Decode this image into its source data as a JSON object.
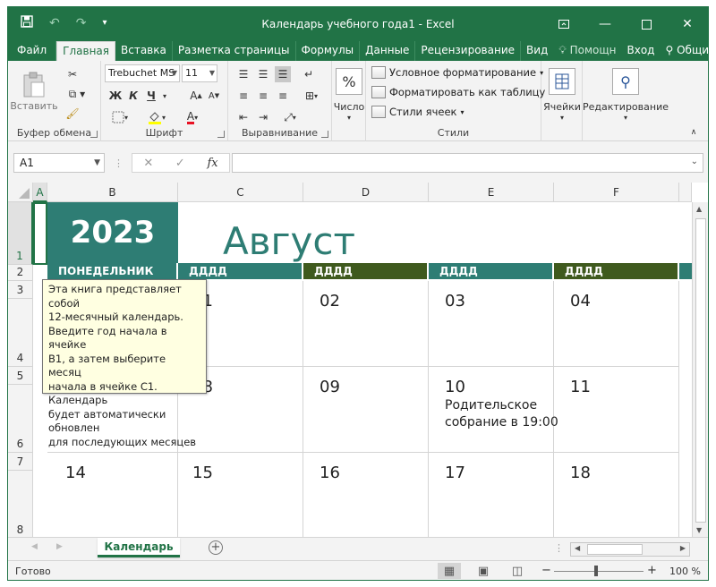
{
  "window": {
    "title": "Календарь учебного года1 - Excel"
  },
  "tabs": {
    "file": "Файл",
    "home": "Главная",
    "insert": "Вставка",
    "layout": "Разметка страницы",
    "formulas": "Формулы",
    "data": "Данные",
    "review": "Рецензирование",
    "view": "Вид",
    "help": "Помощн",
    "login": "Вход",
    "share": "Общий доступ"
  },
  "ribbon": {
    "clipboard": {
      "label": "Буфер обмена",
      "paste": "Вставить"
    },
    "font": {
      "label": "Шрифт",
      "name": "Trebuchet MS",
      "size": "11",
      "bold": "Ж",
      "italic": "К",
      "underline": "Ч"
    },
    "alignment": {
      "label": "Выравнивание"
    },
    "number": {
      "label": "Число",
      "percent_symbol": "%"
    },
    "styles": {
      "label": "Стили",
      "conditional": "Условное форматирование",
      "as_table": "Форматировать как таблицу",
      "cell_styles": "Стили ячеек"
    },
    "cells": {
      "label": "Ячейки"
    },
    "editing": {
      "label": "Редактирование"
    }
  },
  "formula_bar": {
    "name_box": "A1",
    "fx": "fx",
    "value": ""
  },
  "columns": [
    "A",
    "B",
    "C",
    "D",
    "E",
    "F"
  ],
  "rows": [
    "1",
    "2",
    "3",
    "4",
    "5",
    "6",
    "7",
    "8"
  ],
  "calendar": {
    "year": "2023",
    "month": "Август",
    "day_headers": [
      "ПОНЕДЕЛЬНИК",
      "ДДДД",
      "ДДДД",
      "ДДДД",
      "ДДДД"
    ],
    "week1": [
      "01",
      "02",
      "03",
      "04"
    ],
    "week2": [
      "08",
      "09",
      "10",
      "11"
    ],
    "week3": [
      "14",
      "15",
      "16",
      "17",
      "18"
    ],
    "event_line1": "Родительское",
    "event_line2": "собрание в 19:00"
  },
  "tooltip": {
    "lines": [
      "Эта книга представляет собой",
      "12-месячный календарь.",
      "Введите год начала в ячейке",
      "B1, а затем выберите месяц",
      "начала в ячейке C1. Календарь",
      "будет автоматически обновлен",
      "для последующих месяцев"
    ]
  },
  "sheet": {
    "tab": "Календарь"
  },
  "status": {
    "ready": "Готово",
    "zoom": "100 %"
  },
  "colors": {
    "excel_green": "#217346",
    "teal": "#2e7d74",
    "olive": "#3f5a1e"
  }
}
